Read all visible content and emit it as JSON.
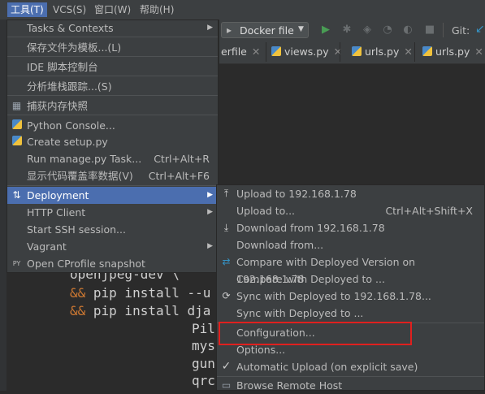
{
  "menubar": {
    "items": [
      {
        "label": "工具(T)",
        "active": true
      },
      {
        "label": "VCS(S)"
      },
      {
        "label": "窗口(W)"
      },
      {
        "label": "帮助(H)"
      }
    ]
  },
  "toolbar": {
    "run_config": "Docker file",
    "git_label": "Git:"
  },
  "tabs": [
    "erfile",
    "views.py",
    "urls.py",
    "urls.py"
  ],
  "editor": {
    "line1": "openjpeg-dev \\",
    "line2_op": "&&",
    "line2": " pip install --u",
    "line3_op": "&&",
    "line3": " pip install dja",
    "line4": "Pil",
    "line5": "mys",
    "line6": "gun",
    "line7": "qrc"
  },
  "tools_menu": {
    "items": [
      {
        "label": "Tasks & Contexts"
      },
      {
        "label": "保存文件为模板...(L)"
      },
      {
        "label": "IDE 脚本控制台"
      },
      {
        "label": "分析堆栈跟踪...(S)"
      },
      {
        "label": "捕获内存快照"
      },
      {
        "label": "Python Console..."
      },
      {
        "label": "Create setup.py"
      },
      {
        "label": "Run manage.py Task...",
        "shortcut": "Ctrl+Alt+R"
      },
      {
        "label": "显示代码覆盖率数据(V)",
        "shortcut": "Ctrl+Alt+F6"
      },
      {
        "label": "Deployment"
      },
      {
        "label": "HTTP Client"
      },
      {
        "label": "Start SSH session..."
      },
      {
        "label": "Vagrant"
      },
      {
        "label": "Open CProfile snapshot"
      }
    ]
  },
  "deployment_menu": {
    "items": [
      {
        "label": "Upload to 192.168.1.78"
      },
      {
        "label": "Upload to...",
        "shortcut": "Ctrl+Alt+Shift+X"
      },
      {
        "label": "Download from 192.168.1.78"
      },
      {
        "label": "Download from..."
      },
      {
        "label": "Compare with Deployed Version on 192.168.1.78"
      },
      {
        "label": "Compare with Deployed to ..."
      },
      {
        "label": "Sync with Deployed to 192.168.1.78..."
      },
      {
        "label": "Sync with Deployed to ..."
      },
      {
        "label": "Configuration..."
      },
      {
        "label": "Options..."
      },
      {
        "label": "Automatic Upload (on explicit save)",
        "checked": true
      },
      {
        "label": "Browse Remote Host"
      }
    ]
  },
  "colors": {
    "selection": "#4b6eaf",
    "highlight_box": "#e0201e",
    "menu_bg": "#3c3f41"
  }
}
